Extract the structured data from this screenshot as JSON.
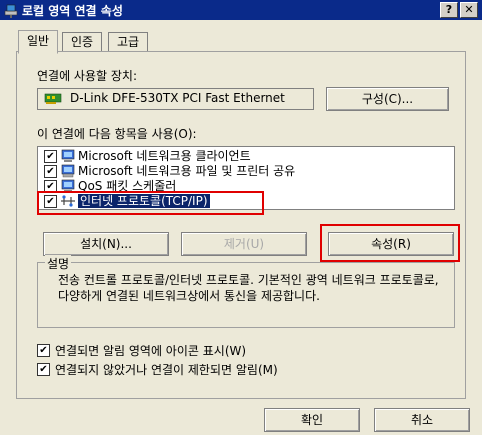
{
  "window": {
    "title": "로컬 영역 연결 속성",
    "help_button": "?",
    "close_button": "✕"
  },
  "tabs": [
    "일반",
    "인증",
    "고급"
  ],
  "connect_using_label": "연결에 사용할 장치:",
  "device_name": "D-Link DFE-530TX PCI Fast Ethernet",
  "configure_button": "구성(C)...",
  "items_label": "이 연결에 다음 항목을 사용(O):",
  "items": [
    {
      "label": "Microsoft 네트워크용 클라이언트",
      "checked": true,
      "icon": "network-client-icon"
    },
    {
      "label": "Microsoft 네트워크용 파일 및 프린터 공유",
      "checked": true,
      "icon": "file-share-icon"
    },
    {
      "label": "QoS 패킷 스케줄러",
      "checked": true,
      "icon": "qos-icon"
    },
    {
      "label": "인터넷 프로토콜(TCP/IP)",
      "checked": true,
      "icon": "protocol-icon",
      "selected": true
    }
  ],
  "buttons": {
    "install": "설치(N)...",
    "remove": "제거(U)",
    "properties": "속성(R)",
    "ok": "확인",
    "cancel": "취소"
  },
  "description": {
    "title": "설명",
    "text": "전송 컨트롤 프로토콜/인터넷 프로토콜. 기본적인 광역 네트워크 프로토콜로, 다양하게 연결된 네트워크상에서 통신을 제공합니다."
  },
  "options": [
    {
      "label": "연결되면 알림 영역에 아이콘 표시(W)",
      "checked": true
    },
    {
      "label": "연결되지 않았거나 연결이 제한되면 알림(M)",
      "checked": true
    }
  ],
  "colors": {
    "titlebar": "#0a2a8a",
    "highlight_box": "#e00000",
    "selection": "#0a246a"
  }
}
